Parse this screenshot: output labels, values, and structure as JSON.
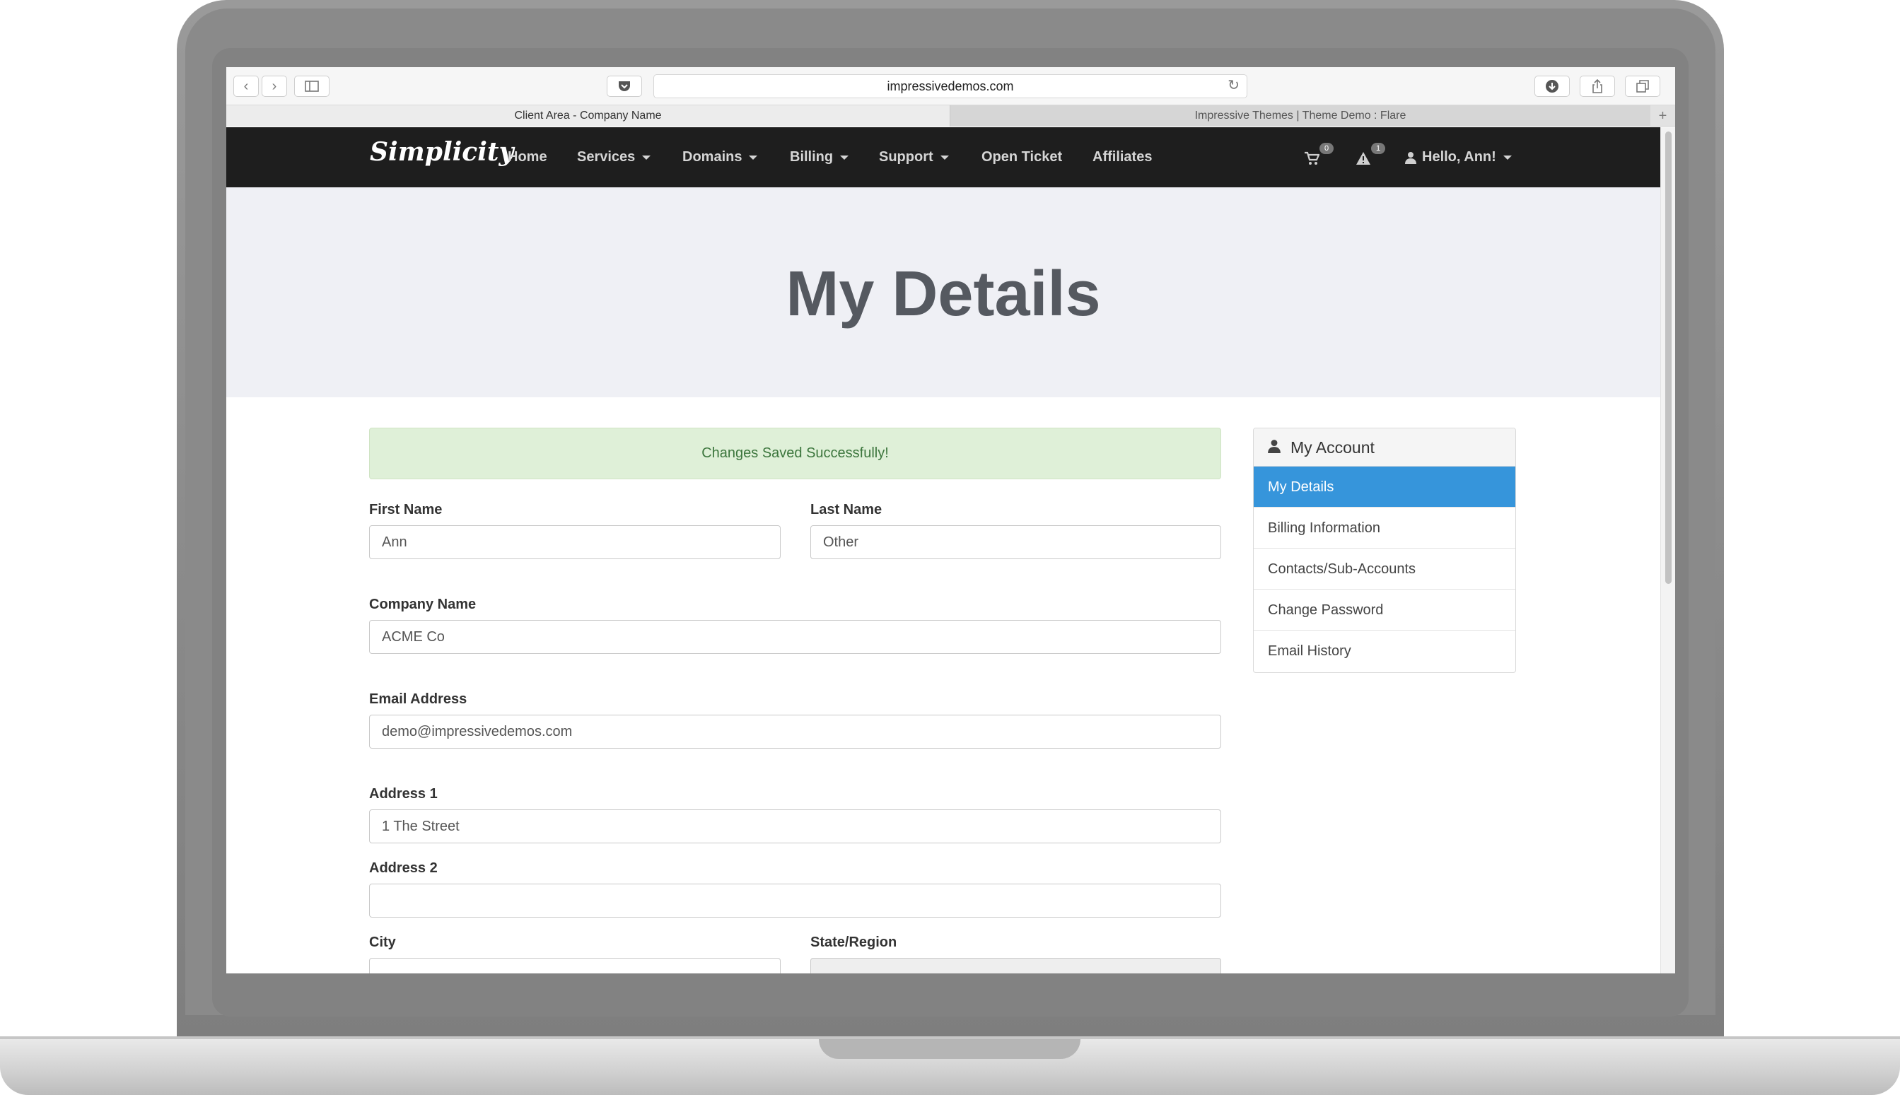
{
  "browser": {
    "url": "impressivedemos.com",
    "tabs": [
      {
        "label": "Client Area - Company Name"
      },
      {
        "label": "Impressive Themes | Theme Demo : Flare"
      }
    ]
  },
  "navbar": {
    "logo": "Simplicity",
    "items": [
      {
        "label": "Home"
      },
      {
        "label": "Services"
      },
      {
        "label": "Domains"
      },
      {
        "label": "Billing"
      },
      {
        "label": "Support"
      },
      {
        "label": "Open Ticket"
      },
      {
        "label": "Affiliates"
      }
    ],
    "cart_count": "0",
    "alert_count": "1",
    "user_greeting": "Hello, Ann!"
  },
  "hero": {
    "title": "My Details"
  },
  "alert": {
    "message": "Changes Saved Successfully!"
  },
  "form": {
    "first_name": {
      "label": "First Name",
      "value": "Ann"
    },
    "last_name": {
      "label": "Last Name",
      "value": "Other"
    },
    "company": {
      "label": "Company Name",
      "value": "ACME Co"
    },
    "email": {
      "label": "Email Address",
      "value": "demo@impressivedemos.com"
    },
    "address1": {
      "label": "Address 1",
      "value": "1 The Street"
    },
    "address2": {
      "label": "Address 2",
      "value": ""
    },
    "city": {
      "label": "City",
      "value": ""
    },
    "state": {
      "label": "State/Region",
      "value": ""
    }
  },
  "sidebar": {
    "title": "My Account",
    "items": [
      {
        "label": "My Details"
      },
      {
        "label": "Billing Information"
      },
      {
        "label": "Contacts/Sub-Accounts"
      },
      {
        "label": "Change Password"
      },
      {
        "label": "Email History"
      }
    ]
  },
  "colors": {
    "navbar_bg": "#1e1e1e",
    "hero_bg": "#eff0f5",
    "success_bg": "#dff0d8",
    "success_text": "#3c763d",
    "active_item_bg": "#3695db"
  }
}
